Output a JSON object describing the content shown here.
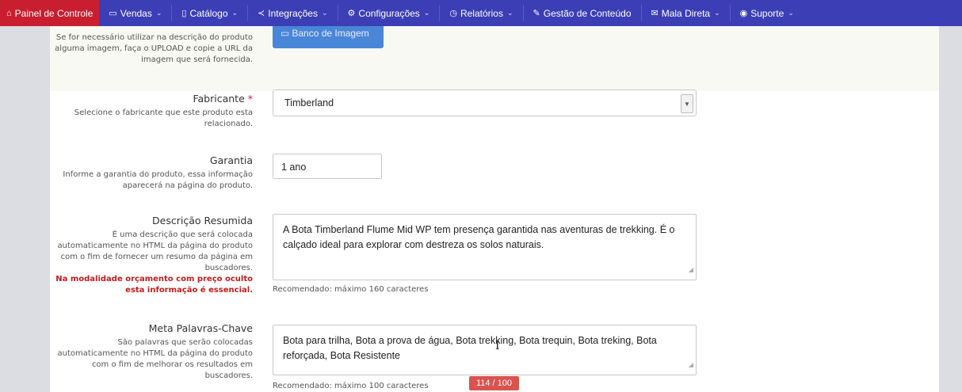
{
  "nav": {
    "items": [
      {
        "label": "Painel de Controle",
        "icon": "home-icon",
        "glyph": "⌂",
        "chevron": false
      },
      {
        "label": "Vendas",
        "icon": "folder-icon",
        "glyph": "▭",
        "chevron": true
      },
      {
        "label": "Catálogo",
        "icon": "book-icon",
        "glyph": "▯",
        "chevron": true
      },
      {
        "label": "Integrações",
        "icon": "share-icon",
        "glyph": "≺",
        "chevron": true
      },
      {
        "label": "Configurações",
        "icon": "gear-icon",
        "glyph": "⚙",
        "chevron": true
      },
      {
        "label": "Relatórios",
        "icon": "history-icon",
        "glyph": "◷",
        "chevron": true
      },
      {
        "label": "Gestão de Conteúdo",
        "icon": "edit-icon",
        "glyph": "✎",
        "chevron": false
      },
      {
        "label": "Mala Direta",
        "icon": "envelope-icon",
        "glyph": "✉",
        "chevron": true
      },
      {
        "label": "Suporte",
        "icon": "lifebuoy-icon",
        "glyph": "◉",
        "chevron": true
      }
    ],
    "active_color": "#c81e2f",
    "bar_color": "#3c3eb5"
  },
  "image_section": {
    "desc": "Se for necessário utilizar na descrição do produto alguma imagem, faça o UPLOAD e copie a URL da imagem que será fornecida.",
    "button_label": "Banco de Imagem",
    "button_icon": "image-icon"
  },
  "manufacturer": {
    "title": "Fabricante",
    "required_mark": "*",
    "desc": "Selecione o fabricante que este produto esta relacionado.",
    "value": "Timberland"
  },
  "warranty": {
    "title": "Garantia",
    "desc": "Informe a garantia do produto, essa informação aparecerá na página do produto.",
    "value": "1 ano"
  },
  "summary": {
    "title": "Descrição Resumida",
    "desc": "É uma descrição que será colocada automaticamente no HTML da página do produto com o fim de fornecer um resumo da página em buscadores.",
    "warning": "Na modalidade orçamento com preço oculto esta informação é essencial.",
    "value": "A Bota Timberland Flume Mid WP tem presença garantida nas aventuras de trekking. É o calçado ideal para explorar com destreza os solos naturais.",
    "hint": "Recomendado: máximo 160 caracteres"
  },
  "keywords": {
    "title": "Meta Palavras-Chave",
    "desc": "São palavras que serão colocadas automaticamente no HTML da página do produto com o fim de melhorar os resultados em buscadores.",
    "value": "Bota para trilha, Bota a prova de água, Bota trekking, Bota trequin, Bota treking, Bota reforçada, Bota Resistente",
    "hint": "Recomendado: máximo 100 caracteres",
    "counter": "114 / 100"
  }
}
